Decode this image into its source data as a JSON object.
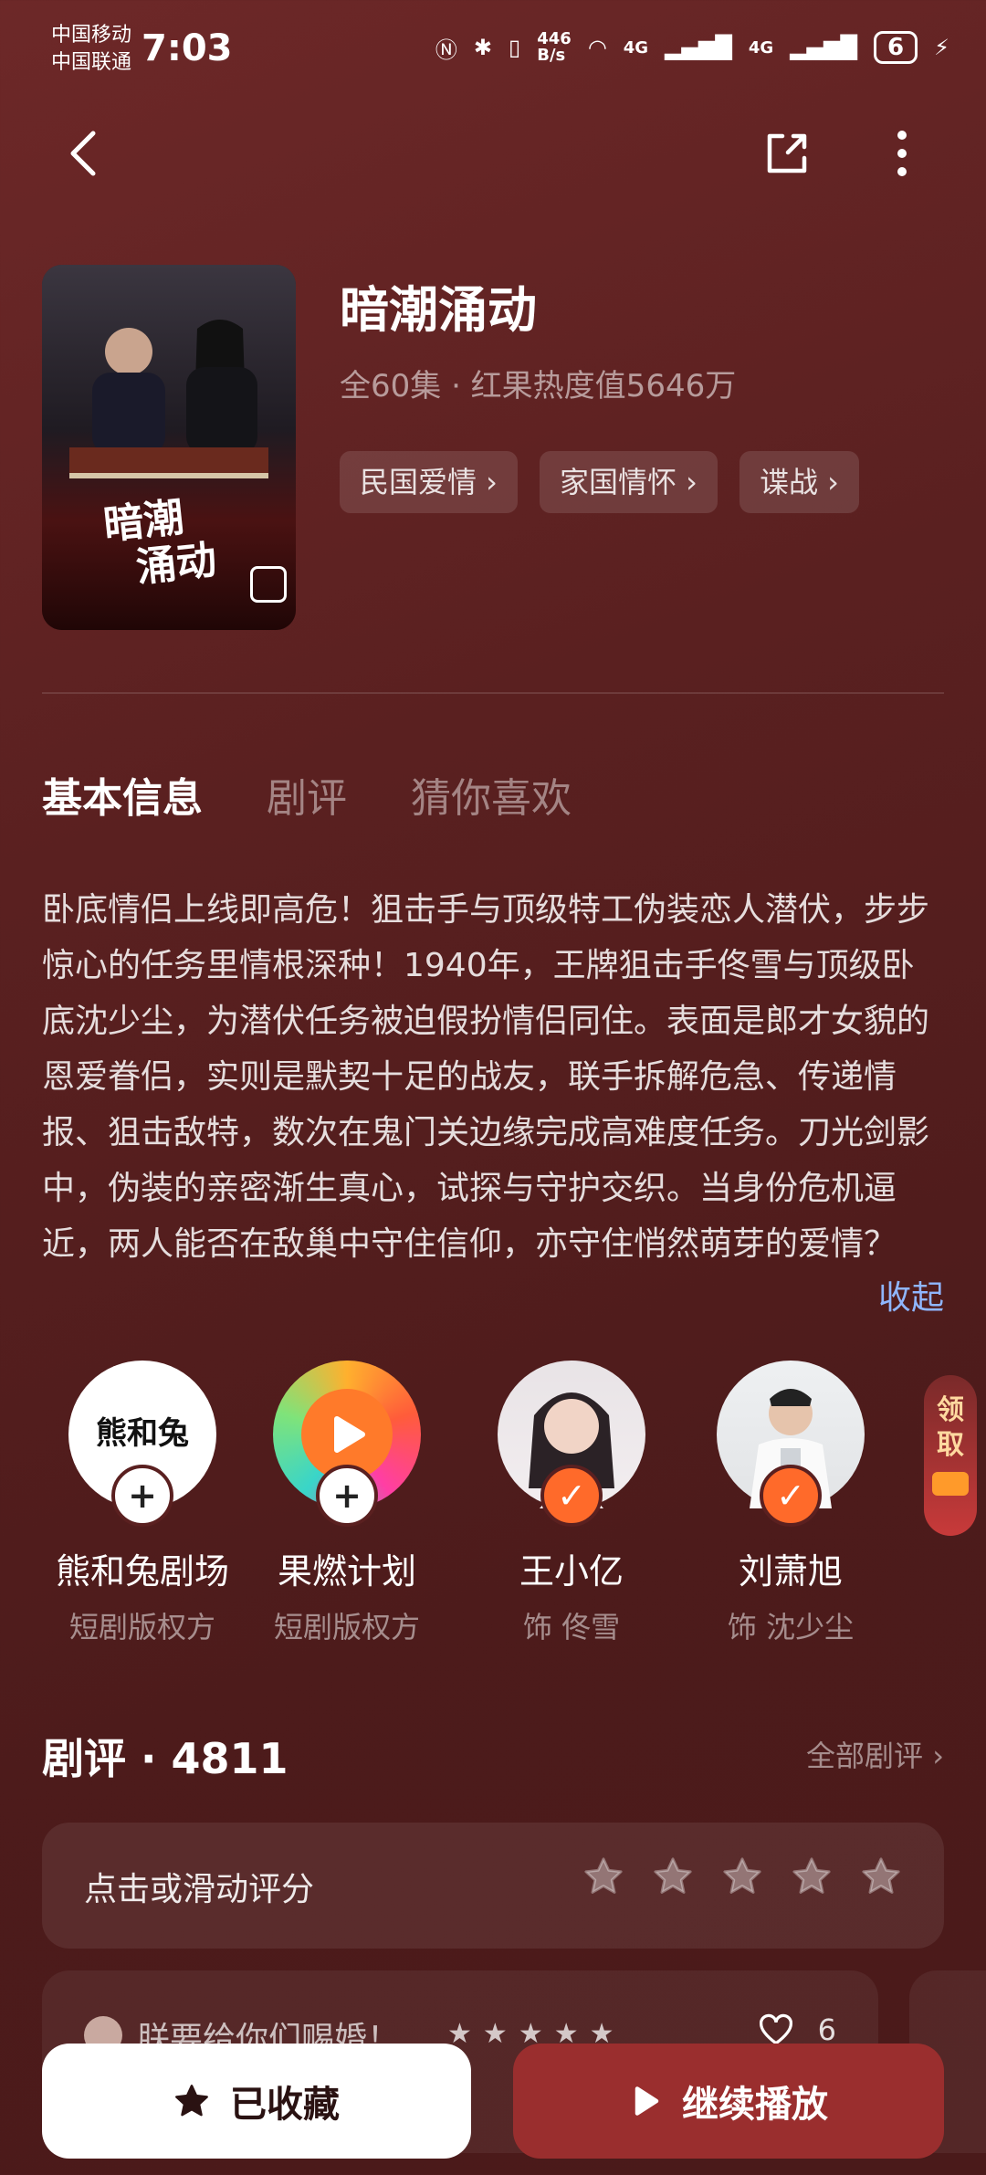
{
  "status_bar": {
    "carrier_1": "中国移动",
    "carrier_2": "中国联通",
    "time": "7:03",
    "net_speed": "446\nB/s",
    "net_label_1": "4G",
    "net_label_2": "4G",
    "battery": "6"
  },
  "drama": {
    "title": "暗潮涌动",
    "meta": "全60集 · 红果热度值5646万",
    "tags": [
      "民国爱情 ›",
      "家国情怀 ›",
      "谍战 ›"
    ],
    "poster_title": "暗潮涌动"
  },
  "tabs": [
    "基本信息",
    "剧评",
    "猜你喜欢"
  ],
  "description": "卧底情侣上线即高危！狙击手与顶级特工伪装恋人潜伏，步步惊心的任务里情根深种！1940年，王牌狙击手佟雪与顶级卧底沈少尘，为潜伏任务被迫假扮情侣同住。表面是郎才女貌的恩爱眷侣，实则是默契十足的战友，联手拆解危急、传递情报、狙击敌特，数次在鬼门关边缘完成高难度任务。刀光剑影中，伪装的亲密渐生真心，试探与守护交织。当身份危机逼近，两人能否在敌巢中守住信仰，亦守住悄然萌芽的爱情？",
  "collapse_label": "收起",
  "people": [
    {
      "name": "熊和兔剧场",
      "role": "短剧版权方",
      "badge": "+",
      "logo_text": "熊和兔"
    },
    {
      "name": "果燃计划",
      "role": "短剧版权方",
      "badge": "+"
    },
    {
      "name": "王小亿",
      "role": "饰 佟雪",
      "badge": "✓"
    },
    {
      "name": "刘萧旭",
      "role": "饰 沈少尘",
      "badge": "✓"
    }
  ],
  "red_packet": "领取",
  "reviews": {
    "title": "剧评 · 4811",
    "all_label": "全部剧评 ›",
    "rate_prompt": "点击或滑动评分",
    "first_review_user": "朕要给你们赐婚！",
    "first_review_likes": "6"
  },
  "buttons": {
    "favorite": "已收藏",
    "play": "继续播放"
  },
  "colors": {
    "accent_orange": "#ff6a2a",
    "link_blue": "#8fb6ff",
    "play_button": "#9a2e2e"
  }
}
